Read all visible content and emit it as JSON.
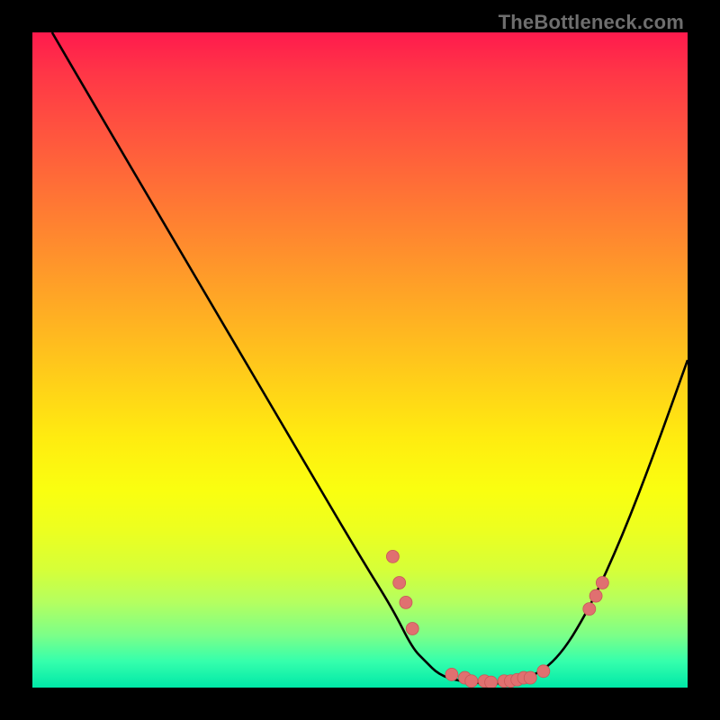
{
  "watermark": "TheBottleneck.com",
  "chart_data": {
    "type": "line",
    "title": "",
    "xlabel": "",
    "ylabel": "",
    "xlim": [
      0,
      100
    ],
    "ylim": [
      0,
      100
    ],
    "series": [
      {
        "name": "curve",
        "x": [
          3,
          10,
          20,
          30,
          40,
          50,
          55,
          58,
          60,
          62,
          65,
          70,
          75,
          80,
          85,
          90,
          95,
          100
        ],
        "y": [
          100,
          88,
          71,
          54,
          37,
          20,
          12,
          6,
          4,
          2,
          1,
          0.5,
          1,
          4,
          12,
          23,
          36,
          50
        ]
      }
    ],
    "points": [
      {
        "x": 55,
        "y": 20
      },
      {
        "x": 56,
        "y": 16
      },
      {
        "x": 57,
        "y": 13
      },
      {
        "x": 58,
        "y": 9
      },
      {
        "x": 64,
        "y": 2
      },
      {
        "x": 66,
        "y": 1.5
      },
      {
        "x": 67,
        "y": 1
      },
      {
        "x": 69,
        "y": 1
      },
      {
        "x": 70,
        "y": 0.8
      },
      {
        "x": 72,
        "y": 1
      },
      {
        "x": 73,
        "y": 1
      },
      {
        "x": 74,
        "y": 1.2
      },
      {
        "x": 75,
        "y": 1.5
      },
      {
        "x": 76,
        "y": 1.5
      },
      {
        "x": 78,
        "y": 2.5
      },
      {
        "x": 85,
        "y": 12
      },
      {
        "x": 86,
        "y": 14
      },
      {
        "x": 87,
        "y": 16
      }
    ]
  }
}
